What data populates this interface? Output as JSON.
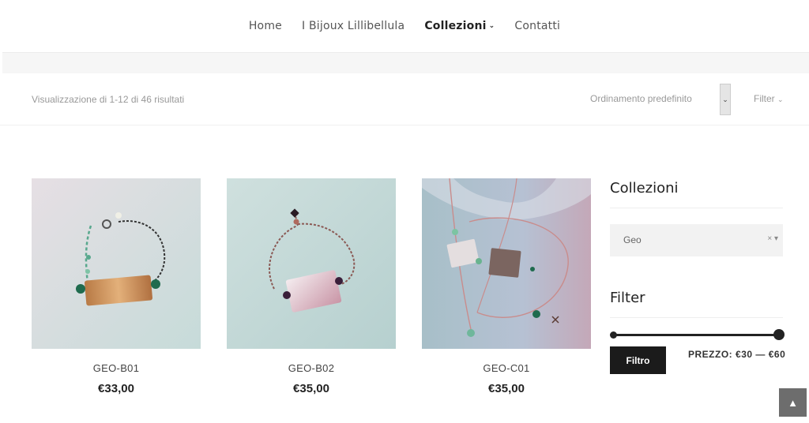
{
  "nav": {
    "items": [
      {
        "label": "Home"
      },
      {
        "label": "I Bijoux Lillibellula"
      },
      {
        "label": "Collezioni",
        "active": true
      },
      {
        "label": "Contatti"
      }
    ]
  },
  "toolbar": {
    "result_count": "Visualizzazione di 1-12 di 46 risultati",
    "sort_label": "Ordinamento predefinito",
    "filter_label": "Filter"
  },
  "products": [
    {
      "name": "GEO-B01",
      "price": "€33,00"
    },
    {
      "name": "GEO-B02",
      "price": "€35,00"
    },
    {
      "name": "GEO-C01",
      "price": "€35,00"
    }
  ],
  "sidebar": {
    "collections_title": "Collezioni",
    "collection_value": "Geo",
    "filter_title": "Filter",
    "filter_button": "Filtro",
    "price_label": "PREZZO:",
    "price_min": "€30",
    "price_max": "€60",
    "price_separator": "—"
  },
  "colors": {
    "accent_dark": "#1b1b1b",
    "band_gray": "#f6f6f6"
  }
}
